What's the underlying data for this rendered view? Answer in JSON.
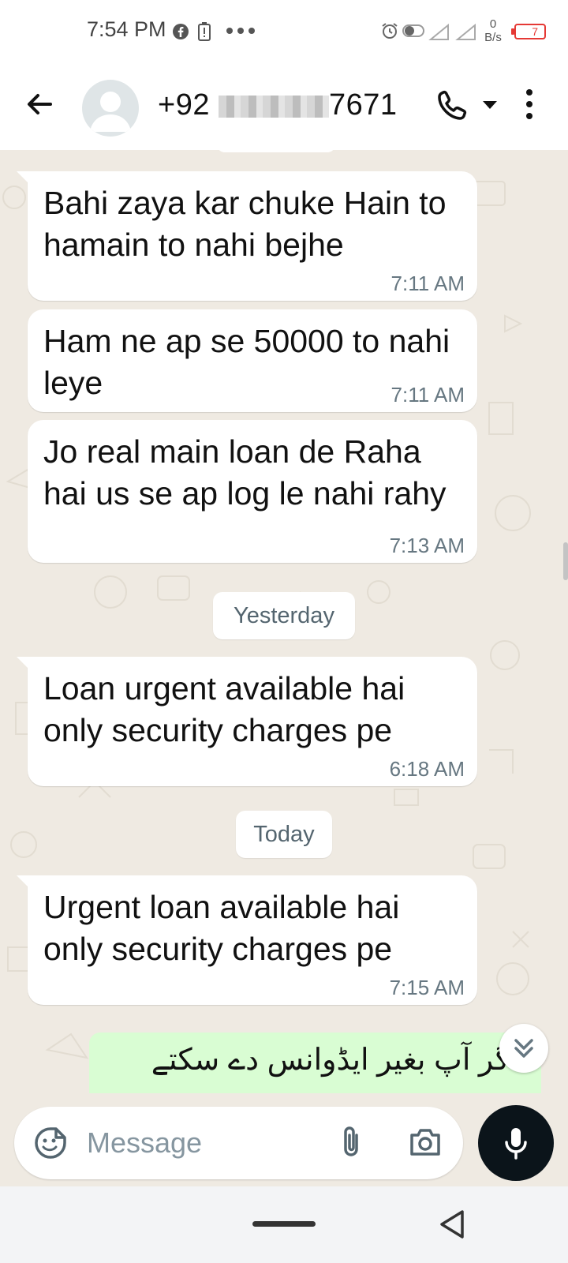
{
  "status_bar": {
    "time": "7:54 PM",
    "net_speed_value": "0",
    "net_speed_unit": "B/s",
    "battery": "7",
    "more_icon": "dots-icon"
  },
  "header": {
    "contact_prefix": "+92",
    "contact_suffix": "7671",
    "icons": [
      "back-arrow-icon",
      "avatar-icon",
      "phone-icon",
      "dropdown-icon",
      "more-vert-icon"
    ]
  },
  "messages": [
    {
      "text": "Bahi zaya kar chuke Hain to hamain to nahi bejhe",
      "time": "7:11 AM"
    },
    {
      "text": "Ham ne ap se 50000 to nahi leye",
      "time": "7:11 AM"
    },
    {
      "text": "Jo real main loan de Raha hai us se ap log le nahi rahy",
      "time": "7:13 AM"
    },
    {
      "text": "Loan urgent available hai only security charges pe",
      "time": "6:18 AM"
    },
    {
      "text": "Urgent loan available hai only security charges pe",
      "time": "7:15 AM"
    }
  ],
  "date_dividers": {
    "yesterday": "Yesterday",
    "today": "Today"
  },
  "outgoing": {
    "text": "گر آپ بغیر ایڈوانس دے سکتے"
  },
  "input": {
    "placeholder": "Message"
  },
  "colors": {
    "chat_bg": "#efeae2",
    "outgoing_bubble": "#d9fdd3",
    "mic_button": "#0b141a",
    "battery_low": "#e53935"
  }
}
